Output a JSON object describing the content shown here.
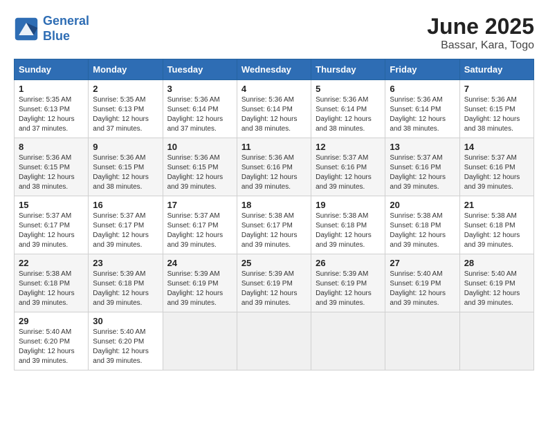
{
  "logo": {
    "line1": "General",
    "line2": "Blue"
  },
  "title": "June 2025",
  "subtitle": "Bassar, Kara, Togo",
  "days_of_week": [
    "Sunday",
    "Monday",
    "Tuesday",
    "Wednesday",
    "Thursday",
    "Friday",
    "Saturday"
  ],
  "weeks": [
    [
      {
        "day": "1",
        "sunrise": "5:35 AM",
        "sunset": "6:13 PM",
        "daylight": "12 hours and 37 minutes."
      },
      {
        "day": "2",
        "sunrise": "5:35 AM",
        "sunset": "6:13 PM",
        "daylight": "12 hours and 37 minutes."
      },
      {
        "day": "3",
        "sunrise": "5:36 AM",
        "sunset": "6:14 PM",
        "daylight": "12 hours and 37 minutes."
      },
      {
        "day": "4",
        "sunrise": "5:36 AM",
        "sunset": "6:14 PM",
        "daylight": "12 hours and 38 minutes."
      },
      {
        "day": "5",
        "sunrise": "5:36 AM",
        "sunset": "6:14 PM",
        "daylight": "12 hours and 38 minutes."
      },
      {
        "day": "6",
        "sunrise": "5:36 AM",
        "sunset": "6:14 PM",
        "daylight": "12 hours and 38 minutes."
      },
      {
        "day": "7",
        "sunrise": "5:36 AM",
        "sunset": "6:15 PM",
        "daylight": "12 hours and 38 minutes."
      }
    ],
    [
      {
        "day": "8",
        "sunrise": "5:36 AM",
        "sunset": "6:15 PM",
        "daylight": "12 hours and 38 minutes."
      },
      {
        "day": "9",
        "sunrise": "5:36 AM",
        "sunset": "6:15 PM",
        "daylight": "12 hours and 38 minutes."
      },
      {
        "day": "10",
        "sunrise": "5:36 AM",
        "sunset": "6:15 PM",
        "daylight": "12 hours and 39 minutes."
      },
      {
        "day": "11",
        "sunrise": "5:36 AM",
        "sunset": "6:16 PM",
        "daylight": "12 hours and 39 minutes."
      },
      {
        "day": "12",
        "sunrise": "5:37 AM",
        "sunset": "6:16 PM",
        "daylight": "12 hours and 39 minutes."
      },
      {
        "day": "13",
        "sunrise": "5:37 AM",
        "sunset": "6:16 PM",
        "daylight": "12 hours and 39 minutes."
      },
      {
        "day": "14",
        "sunrise": "5:37 AM",
        "sunset": "6:16 PM",
        "daylight": "12 hours and 39 minutes."
      }
    ],
    [
      {
        "day": "15",
        "sunrise": "5:37 AM",
        "sunset": "6:17 PM",
        "daylight": "12 hours and 39 minutes."
      },
      {
        "day": "16",
        "sunrise": "5:37 AM",
        "sunset": "6:17 PM",
        "daylight": "12 hours and 39 minutes."
      },
      {
        "day": "17",
        "sunrise": "5:37 AM",
        "sunset": "6:17 PM",
        "daylight": "12 hours and 39 minutes."
      },
      {
        "day": "18",
        "sunrise": "5:38 AM",
        "sunset": "6:17 PM",
        "daylight": "12 hours and 39 minutes."
      },
      {
        "day": "19",
        "sunrise": "5:38 AM",
        "sunset": "6:18 PM",
        "daylight": "12 hours and 39 minutes."
      },
      {
        "day": "20",
        "sunrise": "5:38 AM",
        "sunset": "6:18 PM",
        "daylight": "12 hours and 39 minutes."
      },
      {
        "day": "21",
        "sunrise": "5:38 AM",
        "sunset": "6:18 PM",
        "daylight": "12 hours and 39 minutes."
      }
    ],
    [
      {
        "day": "22",
        "sunrise": "5:38 AM",
        "sunset": "6:18 PM",
        "daylight": "12 hours and 39 minutes."
      },
      {
        "day": "23",
        "sunrise": "5:39 AM",
        "sunset": "6:18 PM",
        "daylight": "12 hours and 39 minutes."
      },
      {
        "day": "24",
        "sunrise": "5:39 AM",
        "sunset": "6:19 PM",
        "daylight": "12 hours and 39 minutes."
      },
      {
        "day": "25",
        "sunrise": "5:39 AM",
        "sunset": "6:19 PM",
        "daylight": "12 hours and 39 minutes."
      },
      {
        "day": "26",
        "sunrise": "5:39 AM",
        "sunset": "6:19 PM",
        "daylight": "12 hours and 39 minutes."
      },
      {
        "day": "27",
        "sunrise": "5:40 AM",
        "sunset": "6:19 PM",
        "daylight": "12 hours and 39 minutes."
      },
      {
        "day": "28",
        "sunrise": "5:40 AM",
        "sunset": "6:19 PM",
        "daylight": "12 hours and 39 minutes."
      }
    ],
    [
      {
        "day": "29",
        "sunrise": "5:40 AM",
        "sunset": "6:20 PM",
        "daylight": "12 hours and 39 minutes."
      },
      {
        "day": "30",
        "sunrise": "5:40 AM",
        "sunset": "6:20 PM",
        "daylight": "12 hours and 39 minutes."
      },
      null,
      null,
      null,
      null,
      null
    ]
  ],
  "labels": {
    "sunrise": "Sunrise:",
    "sunset": "Sunset:",
    "daylight": "Daylight:"
  }
}
